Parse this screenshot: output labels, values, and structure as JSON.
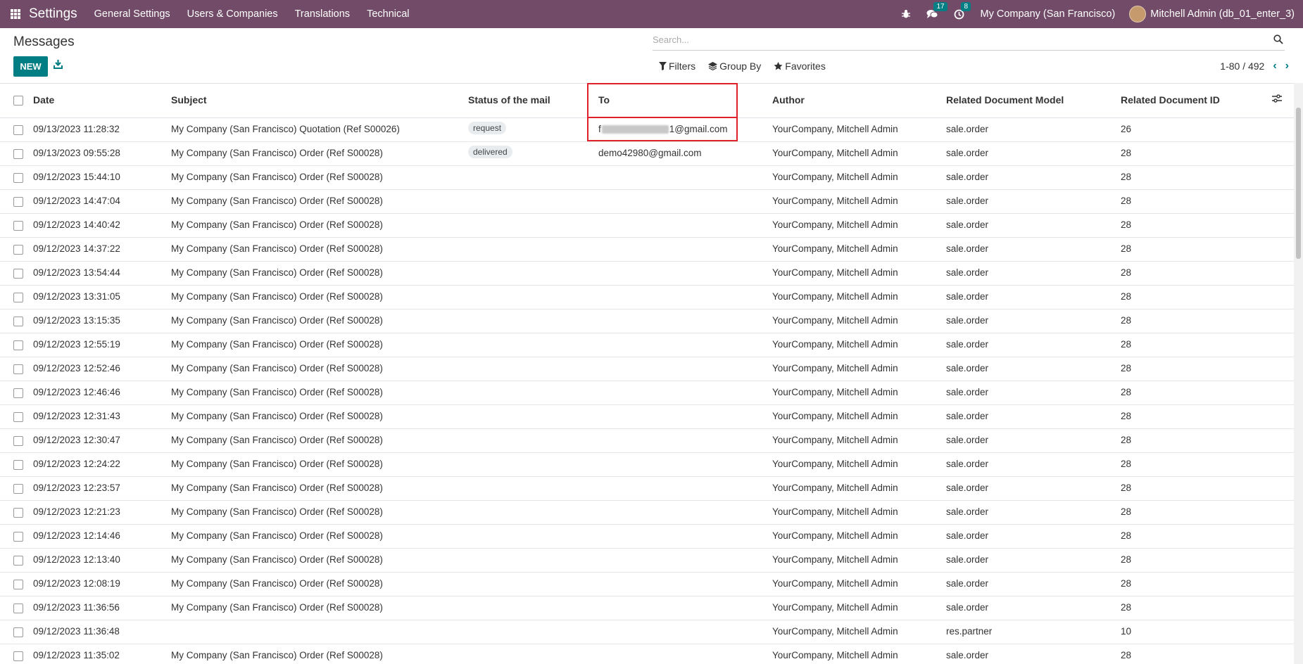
{
  "navbar": {
    "brand": "Settings",
    "menu": [
      "General Settings",
      "Users & Companies",
      "Translations",
      "Technical"
    ],
    "icons": [
      "apps-grid-icon",
      "bug-icon",
      "chat-icon",
      "clock-icon"
    ],
    "chat_count": "17",
    "activity_count": "8",
    "company": "My Company (San Francisco)",
    "user": "Mitchell Admin (db_01_enter_3)",
    "color": "#714b67"
  },
  "control_panel": {
    "title": "Messages",
    "new_label": "NEW",
    "search_placeholder": "Search...",
    "filters_label": "Filters",
    "group_by_label": "Group By",
    "favorites_label": "Favorites",
    "pager": "1-80 / 492",
    "accent": "#017e84"
  },
  "table": {
    "headers": {
      "date": "Date",
      "subject": "Subject",
      "status": "Status of the mail",
      "to": "To",
      "author": "Author",
      "model": "Related Document Model",
      "res_id": "Related Document ID"
    },
    "rows": [
      {
        "date": "09/13/2023 11:28:32",
        "subject": "My Company (San Francisco) Quotation (Ref S00026)",
        "status": "request",
        "to_prefix": "f",
        "to_suffix": "1@gmail.com",
        "to_redacted": true,
        "author": "YourCompany, Mitchell Admin",
        "model": "sale.order",
        "res_id": "26"
      },
      {
        "date": "09/13/2023 09:55:28",
        "subject": "My Company (San Francisco) Order (Ref S00028)",
        "status": "delivered",
        "to": "demo42980@gmail.com",
        "author": "YourCompany, Mitchell Admin",
        "model": "sale.order",
        "res_id": "28"
      },
      {
        "date": "09/12/2023 15:44:10",
        "subject": "My Company (San Francisco) Order (Ref S00028)",
        "author": "YourCompany, Mitchell Admin",
        "model": "sale.order",
        "res_id": "28"
      },
      {
        "date": "09/12/2023 14:47:04",
        "subject": "My Company (San Francisco) Order (Ref S00028)",
        "author": "YourCompany, Mitchell Admin",
        "model": "sale.order",
        "res_id": "28"
      },
      {
        "date": "09/12/2023 14:40:42",
        "subject": "My Company (San Francisco) Order (Ref S00028)",
        "author": "YourCompany, Mitchell Admin",
        "model": "sale.order",
        "res_id": "28"
      },
      {
        "date": "09/12/2023 14:37:22",
        "subject": "My Company (San Francisco) Order (Ref S00028)",
        "author": "YourCompany, Mitchell Admin",
        "model": "sale.order",
        "res_id": "28"
      },
      {
        "date": "09/12/2023 13:54:44",
        "subject": "My Company (San Francisco) Order (Ref S00028)",
        "author": "YourCompany, Mitchell Admin",
        "model": "sale.order",
        "res_id": "28"
      },
      {
        "date": "09/12/2023 13:31:05",
        "subject": "My Company (San Francisco) Order (Ref S00028)",
        "author": "YourCompany, Mitchell Admin",
        "model": "sale.order",
        "res_id": "28"
      },
      {
        "date": "09/12/2023 13:15:35",
        "subject": "My Company (San Francisco) Order (Ref S00028)",
        "author": "YourCompany, Mitchell Admin",
        "model": "sale.order",
        "res_id": "28"
      },
      {
        "date": "09/12/2023 12:55:19",
        "subject": "My Company (San Francisco) Order (Ref S00028)",
        "author": "YourCompany, Mitchell Admin",
        "model": "sale.order",
        "res_id": "28"
      },
      {
        "date": "09/12/2023 12:52:46",
        "subject": "My Company (San Francisco) Order (Ref S00028)",
        "author": "YourCompany, Mitchell Admin",
        "model": "sale.order",
        "res_id": "28"
      },
      {
        "date": "09/12/2023 12:46:46",
        "subject": "My Company (San Francisco) Order (Ref S00028)",
        "author": "YourCompany, Mitchell Admin",
        "model": "sale.order",
        "res_id": "28"
      },
      {
        "date": "09/12/2023 12:31:43",
        "subject": "My Company (San Francisco) Order (Ref S00028)",
        "author": "YourCompany, Mitchell Admin",
        "model": "sale.order",
        "res_id": "28"
      },
      {
        "date": "09/12/2023 12:30:47",
        "subject": "My Company (San Francisco) Order (Ref S00028)",
        "author": "YourCompany, Mitchell Admin",
        "model": "sale.order",
        "res_id": "28"
      },
      {
        "date": "09/12/2023 12:24:22",
        "subject": "My Company (San Francisco) Order (Ref S00028)",
        "author": "YourCompany, Mitchell Admin",
        "model": "sale.order",
        "res_id": "28"
      },
      {
        "date": "09/12/2023 12:23:57",
        "subject": "My Company (San Francisco) Order (Ref S00028)",
        "author": "YourCompany, Mitchell Admin",
        "model": "sale.order",
        "res_id": "28"
      },
      {
        "date": "09/12/2023 12:21:23",
        "subject": "My Company (San Francisco) Order (Ref S00028)",
        "author": "YourCompany, Mitchell Admin",
        "model": "sale.order",
        "res_id": "28"
      },
      {
        "date": "09/12/2023 12:14:46",
        "subject": "My Company (San Francisco) Order (Ref S00028)",
        "author": "YourCompany, Mitchell Admin",
        "model": "sale.order",
        "res_id": "28"
      },
      {
        "date": "09/12/2023 12:13:40",
        "subject": "My Company (San Francisco) Order (Ref S00028)",
        "author": "YourCompany, Mitchell Admin",
        "model": "sale.order",
        "res_id": "28"
      },
      {
        "date": "09/12/2023 12:08:19",
        "subject": "My Company (San Francisco) Order (Ref S00028)",
        "author": "YourCompany, Mitchell Admin",
        "model": "sale.order",
        "res_id": "28"
      },
      {
        "date": "09/12/2023 11:36:56",
        "subject": "My Company (San Francisco) Order (Ref S00028)",
        "author": "YourCompany, Mitchell Admin",
        "model": "sale.order",
        "res_id": "28"
      },
      {
        "date": "09/12/2023 11:36:48",
        "subject": "",
        "author": "YourCompany, Mitchell Admin",
        "model": "res.partner",
        "res_id": "10"
      },
      {
        "date": "09/12/2023 11:35:02",
        "subject": "My Company (San Francisco) Order (Ref S00028)",
        "author": "YourCompany, Mitchell Admin",
        "model": "sale.order",
        "res_id": "28"
      }
    ]
  }
}
